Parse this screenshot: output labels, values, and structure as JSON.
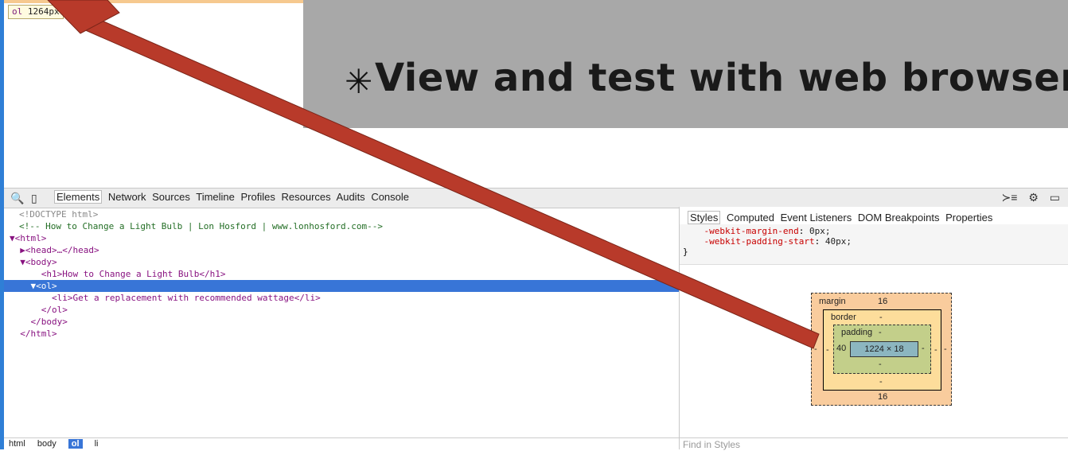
{
  "tooltip": {
    "tag": "ol",
    "size": "1264px"
  },
  "slide": {
    "bullet": "✳",
    "text": "View and test with web browser"
  },
  "devtools": {
    "search_icon": "🔍",
    "device_icon": "▯",
    "tabs": [
      "Elements",
      "Network",
      "Sources",
      "Timeline",
      "Profiles",
      "Resources",
      "Audits",
      "Console"
    ],
    "right_icons": [
      "≻≡",
      "⚙",
      "▭"
    ]
  },
  "elements": {
    "lines": [
      "<!DOCTYPE html>",
      "<!-- How to Change a Light Bulb | Lon Hosford | www.lonhosford.com-->",
      "▼<html>",
      "  ▶<head>…</head>",
      "  ▼<body>",
      "      <h1>How to Change a Light Bulb</h1>",
      "    ▼<ol>",
      "        <li>Get a replacement with recommended wattage</li>",
      "      </ol>",
      "    </body>",
      "  </html>"
    ]
  },
  "styles": {
    "tabs": [
      "Styles",
      "Computed",
      "Event Listeners",
      "DOM Breakpoints",
      "Properties"
    ],
    "rules": [
      {
        "prop": "-webkit-margin-end",
        "val": "0px;"
      },
      {
        "prop": "-webkit-padding-start",
        "val": "40px;"
      }
    ],
    "close_brace": "}"
  },
  "box_model": {
    "margin_label": "margin",
    "margin_top": "16",
    "margin_bottom": "16",
    "margin_left": "-",
    "margin_right": "-",
    "border_label": "border",
    "border_top": "-",
    "border_bottom": "-",
    "border_left": "-",
    "border_right": "-",
    "padding_label": "padding",
    "padding_top": "-",
    "padding_bottom": "-",
    "padding_left": "40",
    "padding_right": "-",
    "content": "1224 × 18"
  },
  "breadcrumb": [
    "html",
    "body",
    "ol",
    "li"
  ],
  "find_in_styles": "Find in Styles",
  "colors": {
    "arrow": "#b83a2a",
    "selection": "#3875d7",
    "banner": "#a8a8a8"
  }
}
